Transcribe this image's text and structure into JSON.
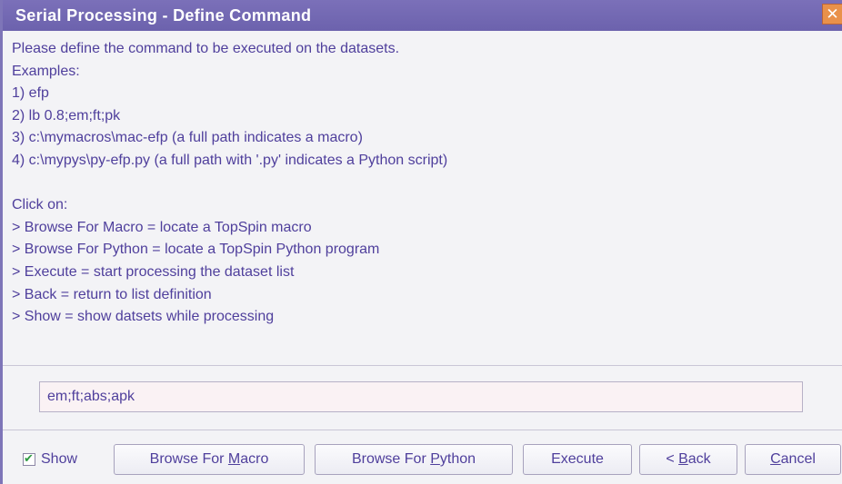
{
  "window": {
    "title": "Serial Processing - Define Command",
    "close_icon": "close-icon"
  },
  "message": {
    "lines": [
      "Please define the command to be executed on the datasets.",
      "Examples:",
      "1) efp",
      "2) lb 0.8;em;ft;pk",
      "3) c:\\mymacros\\mac-efp (a full path indicates a macro)",
      "4) c:\\mypys\\py-efp.py (a full path with '.py' indicates a Python script)",
      "",
      "Click on:",
      "> Browse For Macro = locate a TopSpin macro",
      "> Browse For Python = locate a TopSpin Python program",
      "> Execute = start processing the dataset list",
      "> Back = return to list definition",
      "> Show = show datsets while processing"
    ]
  },
  "command": {
    "value": "em;ft;abs;apk"
  },
  "controls": {
    "show_label": "Show",
    "show_checked": true,
    "browse_macro": {
      "pre": "Browse For ",
      "mnemonic": "M",
      "post": "acro"
    },
    "browse_python": {
      "pre": "Browse For ",
      "mnemonic": "P",
      "post": "ython"
    },
    "execute": "Execute",
    "back": {
      "pre": "< ",
      "mnemonic": "B",
      "post": "ack"
    },
    "cancel": {
      "pre": "",
      "mnemonic": "C",
      "post": "ancel"
    }
  },
  "colors": {
    "title_bar": "#6c62ad",
    "text": "#4f3f9c",
    "close_button": "#e9914a",
    "input_bg": "#faf2f4"
  }
}
